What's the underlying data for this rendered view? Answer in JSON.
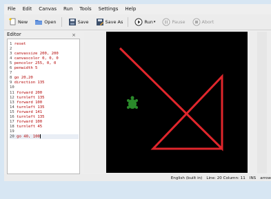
{
  "menu": [
    "File",
    "Edit",
    "Canvas",
    "Run",
    "Tools",
    "Settings",
    "Help"
  ],
  "toolbar": {
    "new_label": "New",
    "open_label": "Open",
    "save_label": "Save",
    "saveas_label": "Save As",
    "run_label": "Run",
    "pause_label": "Pause",
    "abort_label": "Abort"
  },
  "editor": {
    "title": "Editor",
    "close_glyph": "×",
    "lines": [
      {
        "num": "1",
        "text": "reset"
      },
      {
        "num": "2",
        "text": ""
      },
      {
        "num": "3",
        "text": "canvassize 200, 200"
      },
      {
        "num": "4",
        "text": "canvascolor 0, 0, 0"
      },
      {
        "num": "5",
        "text": "pencolor 255, 0, 0"
      },
      {
        "num": "6",
        "text": "penwidth 5"
      },
      {
        "num": "7",
        "text": ""
      },
      {
        "num": "8",
        "text": "go 20,20"
      },
      {
        "num": "9",
        "text": "direction 135"
      },
      {
        "num": "10",
        "text": ""
      },
      {
        "num": "11",
        "text": "forward 200"
      },
      {
        "num": "12",
        "text": "turnleft 135"
      },
      {
        "num": "13",
        "text": "forward 100"
      },
      {
        "num": "14",
        "text": "turnleft 135"
      },
      {
        "num": "15",
        "text": "forward 141"
      },
      {
        "num": "16",
        "text": "turnleft 135"
      },
      {
        "num": "17",
        "text": "forward 100"
      },
      {
        "num": "18",
        "text": "turnleft 45"
      },
      {
        "num": "19",
        "text": ""
      },
      {
        "num": "20",
        "text": "go 40, 100"
      }
    ]
  },
  "status": {
    "language": "English (built in)",
    "position": "Line: 20 Column: 11",
    "mode": "INS",
    "cursor": "arrow"
  },
  "colors": {
    "pen": "#e0262c",
    "canvas": "#000000",
    "turtle": "#2a8a2a"
  }
}
